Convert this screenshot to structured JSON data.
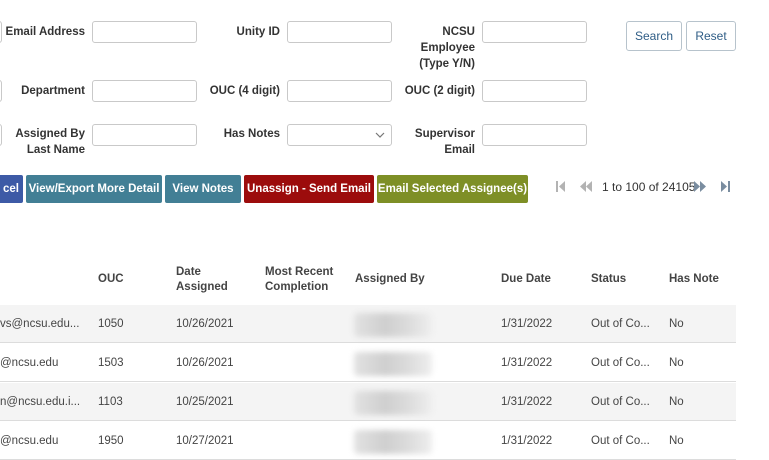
{
  "filters": {
    "email_address_label": "Email Address",
    "unity_id_label": "Unity ID",
    "ncsu_employee_label_line1": "NCSU",
    "ncsu_employee_label_line2": "Employee",
    "ncsu_employee_label_line3": "(Type Y/N)",
    "department_label": "Department",
    "ouc4_label": "OUC (4 digit)",
    "ouc2_label": "OUC (2 digit)",
    "assigned_by_label_line1": "Assigned By",
    "assigned_by_label_line2": "Last Name",
    "has_notes_label": "Has Notes",
    "supervisor_email_label_line1": "Supervisor",
    "supervisor_email_label_line2": "Email",
    "has_notes_value": ""
  },
  "buttons": {
    "search": "Search",
    "reset": "Reset",
    "excel_partial": "cel",
    "view_export": "View/Export More Detail",
    "view_notes": "View Notes",
    "unassign": "Unassign - Send Email",
    "email_selected": "Email Selected Assignee(s)"
  },
  "colors": {
    "excel_button": "#3d5aa6",
    "view_export_button": "#427f95",
    "view_notes_button": "#427f95",
    "unassign_button": "#9c0c0c",
    "email_selected_button": "#7e8f26"
  },
  "pagination": {
    "range": "1 to 100 of 24105",
    "first_icon": "first-page-icon",
    "prev_icon": "previous-page-icon",
    "next_icon": "next-page-icon",
    "last_icon": "last-page-icon"
  },
  "table": {
    "headers": {
      "ouc": "OUC",
      "date_assigned_line1": "Date",
      "date_assigned_line2": "Assigned",
      "recent_line1": "Most Recent",
      "recent_line2": "Completion",
      "assigned_by": "Assigned By",
      "due_date": "Due Date",
      "status": "Status",
      "has_note": "Has Note"
    },
    "rows": [
      {
        "email": "vs@ncsu.edu...",
        "ouc": "1050",
        "date_assigned": "10/26/2021",
        "recent": "",
        "due": "1/31/2022",
        "status": "Out of Co...",
        "has_note": "No"
      },
      {
        "email": "@ncsu.edu",
        "ouc": "1503",
        "date_assigned": "10/26/2021",
        "recent": "",
        "due": "1/31/2022",
        "status": "Out of Co...",
        "has_note": "No"
      },
      {
        "email": "n@ncsu.edu.i...",
        "ouc": "1103",
        "date_assigned": "10/25/2021",
        "recent": "",
        "due": "1/31/2022",
        "status": "Out of Co...",
        "has_note": "No"
      },
      {
        "email": "@ncsu.edu",
        "ouc": "1950",
        "date_assigned": "10/27/2021",
        "recent": "",
        "due": "1/31/2022",
        "status": "Out of Co...",
        "has_note": "No"
      }
    ]
  }
}
